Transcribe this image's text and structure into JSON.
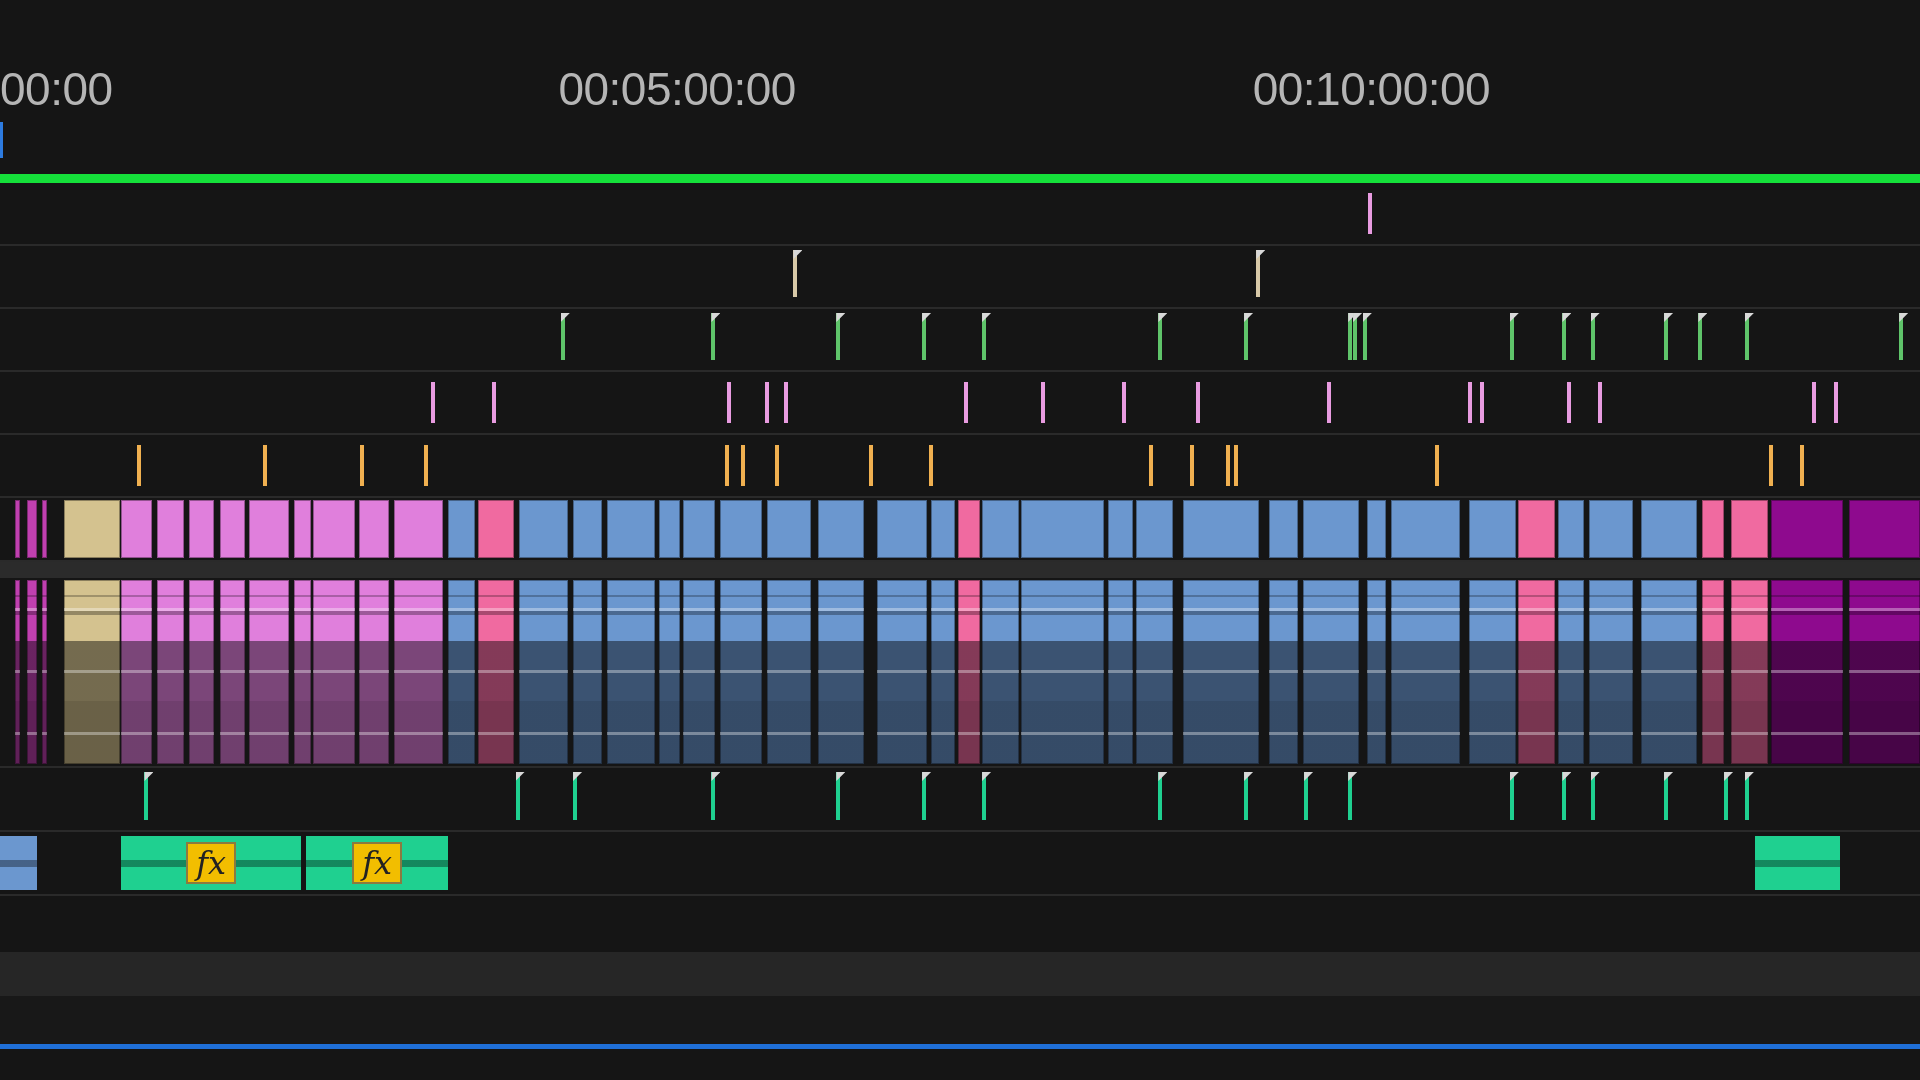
{
  "ruler": {
    "labels": [
      "00:00",
      "00:05:00:00",
      "00:10:00:00"
    ]
  },
  "marker_tracks": [
    {
      "color": "#e89be0",
      "flagged": false
    },
    {
      "color": "#d8c9a8",
      "flagged": true
    },
    {
      "color": "#5fc46a",
      "flagged": true
    },
    {
      "color": "#e89be0",
      "flagged": false
    },
    {
      "color": "#f0b050",
      "flagged": false
    }
  ],
  "video_clips": [
    {
      "color": "#c040b0"
    },
    {
      "color": "#c040b0"
    },
    {
      "color": "#c040b0"
    },
    {
      "color": "#d4c28f"
    },
    {
      "color": "#e07fdc"
    },
    {
      "color": "#e07fdc"
    },
    {
      "color": "#e07fdc"
    },
    {
      "color": "#e07fdc"
    },
    {
      "color": "#e07fdc"
    },
    {
      "color": "#e07fdc"
    },
    {
      "color": "#e07fdc"
    },
    {
      "color": "#e07fdc"
    },
    {
      "color": "#e07fdc"
    },
    {
      "color": "#6b97cf"
    },
    {
      "color": "#f06aa0"
    },
    {
      "color": "#6b97cf"
    },
    {
      "color": "#6b97cf"
    },
    {
      "color": "#6b97cf"
    },
    {
      "color": "#6b97cf"
    },
    {
      "color": "#6b97cf"
    },
    {
      "color": "#6b97cf"
    },
    {
      "color": "#6b97cf"
    },
    {
      "color": "#6b97cf"
    },
    {
      "color": "#6b97cf"
    },
    {
      "color": "#6b97cf"
    },
    {
      "color": "#f06aa0"
    },
    {
      "color": "#6b97cf"
    },
    {
      "color": "#6b97cf"
    },
    {
      "color": "#6b97cf"
    },
    {
      "color": "#6b97cf"
    },
    {
      "color": "#6b97cf"
    },
    {
      "color": "#6b97cf"
    },
    {
      "color": "#6b97cf"
    },
    {
      "color": "#6b97cf"
    },
    {
      "color": "#6b97cf"
    },
    {
      "color": "#6b97cf"
    },
    {
      "color": "#f06aa0"
    },
    {
      "color": "#6b97cf"
    },
    {
      "color": "#6b97cf"
    },
    {
      "color": "#6b97cf"
    },
    {
      "color": "#f06aa0"
    },
    {
      "color": "#f06aa0"
    },
    {
      "color": "#8e0a8e"
    },
    {
      "color": "#8e0a8e"
    }
  ],
  "audio_clips": [
    {
      "color": "#c040b0"
    },
    {
      "color": "#c040b0"
    },
    {
      "color": "#c040b0"
    },
    {
      "color": "#d4c28f"
    },
    {
      "color": "#e07fdc"
    },
    {
      "color": "#e07fdc"
    },
    {
      "color": "#e07fdc"
    },
    {
      "color": "#e07fdc"
    },
    {
      "color": "#e07fdc"
    },
    {
      "color": "#e07fdc"
    },
    {
      "color": "#e07fdc"
    },
    {
      "color": "#e07fdc"
    },
    {
      "color": "#e07fdc"
    },
    {
      "color": "#6b97cf"
    },
    {
      "color": "#f06aa0"
    },
    {
      "color": "#6b97cf"
    },
    {
      "color": "#6b97cf"
    },
    {
      "color": "#6b97cf"
    },
    {
      "color": "#6b97cf"
    },
    {
      "color": "#6b97cf"
    },
    {
      "color": "#6b97cf"
    },
    {
      "color": "#6b97cf"
    },
    {
      "color": "#6b97cf"
    },
    {
      "color": "#6b97cf"
    },
    {
      "color": "#6b97cf"
    },
    {
      "color": "#f06aa0"
    },
    {
      "color": "#6b97cf"
    },
    {
      "color": "#6b97cf"
    },
    {
      "color": "#6b97cf"
    },
    {
      "color": "#6b97cf"
    },
    {
      "color": "#6b97cf"
    },
    {
      "color": "#6b97cf"
    },
    {
      "color": "#6b97cf"
    },
    {
      "color": "#6b97cf"
    },
    {
      "color": "#6b97cf"
    },
    {
      "color": "#6b97cf"
    },
    {
      "color": "#f06aa0"
    },
    {
      "color": "#6b97cf"
    },
    {
      "color": "#6b97cf"
    },
    {
      "color": "#6b97cf"
    },
    {
      "color": "#f06aa0"
    },
    {
      "color": "#f06aa0"
    },
    {
      "color": "#8e0a8e"
    },
    {
      "color": "#8e0a8e"
    }
  ],
  "lower_marker_track": {
    "color": "#1fd090",
    "flagged": true
  },
  "effect_clips": [
    {
      "color": "#6b97cf"
    },
    {
      "color": "#1fd090",
      "badge": "fx"
    },
    {
      "color": "#1fd090",
      "badge": "fx"
    },
    {
      "color": "#1fd090"
    }
  ]
}
